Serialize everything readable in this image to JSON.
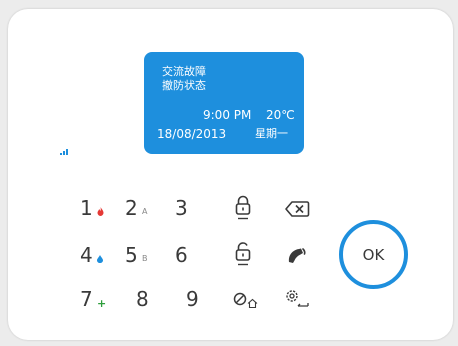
{
  "lcd": {
    "line1": "交流故障",
    "line2": "撤防状态",
    "time": "9:00 PM",
    "temperature": "20℃",
    "date": "18/08/2013",
    "weekday": "星期一"
  },
  "keypad": {
    "keys": [
      {
        "digit": "1",
        "sub": "fire",
        "sub_color": "#e53935"
      },
      {
        "digit": "2",
        "sub": "A"
      },
      {
        "digit": "3"
      },
      {
        "digit": "4",
        "sub": "water",
        "sub_color": "#1e8fdd"
      },
      {
        "digit": "5",
        "sub": "B"
      },
      {
        "digit": "6"
      },
      {
        "digit": "7",
        "sub": "+",
        "sub_color": "#2e9e3c"
      },
      {
        "digit": "8"
      },
      {
        "digit": "9"
      }
    ],
    "ok_label": "OK",
    "icons": [
      "arm-lock-icon",
      "backspace-icon",
      "disarm-unlock-icon",
      "phone-icon",
      "no-home-arm-icon",
      "settings-icon"
    ]
  },
  "colors": {
    "accent": "#1e8fdd",
    "panel": "#ffffff",
    "background": "#ececec",
    "key_text": "#3a3a3a"
  }
}
